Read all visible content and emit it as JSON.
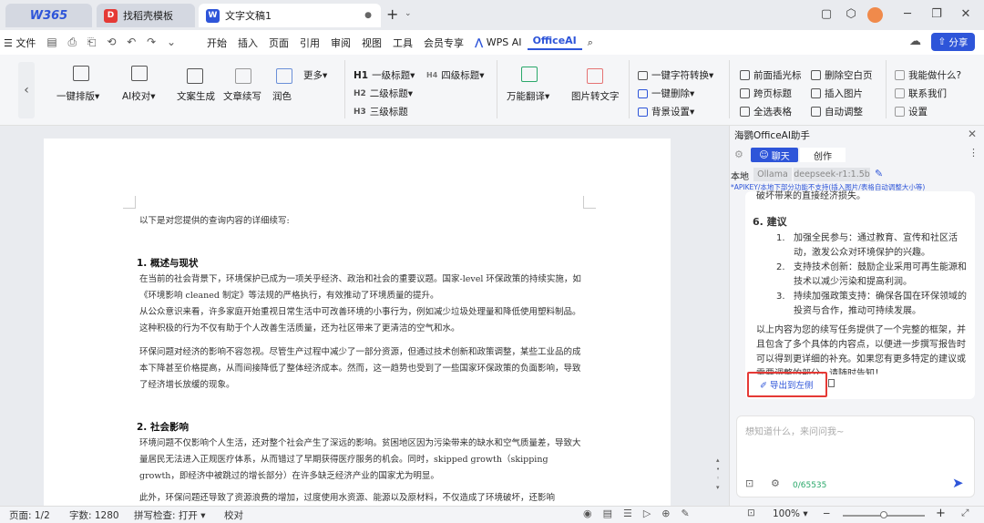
{
  "titlebar": {
    "home_tab": "W365",
    "template_tab": "找稻壳模板",
    "doc_tab": "文字文稿1",
    "new_tab": "+"
  },
  "menubar": {
    "file": "文件",
    "items": [
      "开始",
      "插入",
      "页面",
      "引用",
      "审阅",
      "视图",
      "工具",
      "会员专享"
    ],
    "wps_ai": "WPS AI",
    "office_ai": "OfficeAI",
    "share": "分享"
  },
  "ribbon": {
    "one_click_layout": "一键排版",
    "ai_proofread": "AI校对",
    "text_gen": "文案生成",
    "text_continue": "文章续写",
    "polish": "润色",
    "more": "更多",
    "h1": "一级标题",
    "h2": "二级标题",
    "h3": "三级标题",
    "h4": "四级标题",
    "translate": "万能翻译",
    "img_to_text": "图片转文字",
    "convert": "一键字符转换",
    "delete": "一键删除",
    "bg_settings": "背景设置",
    "cursor_front": "前面插光标",
    "cross_page_title": "跨页标题",
    "select_table": "全选表格",
    "delete_blank": "删除空白页",
    "insert_image": "插入图片",
    "auto_adjust": "自动调整",
    "what_can_do": "我能做什么?",
    "contact": "联系我们",
    "settings": "设置"
  },
  "document": {
    "intro": "以下是对您提供的查询内容的详细续写:",
    "s1_title": "1. 概述与现状",
    "s1_p1": "在当前的社会背景下，环境保护已成为一项关乎经济、政治和社会的重要议题。国家-level 环保政策的持续实施，如《环境影响 cleaned 制定》等法规的严格执行，有效推动了环境质量的提升。",
    "s1_p2": "从公众意识来看，许多家庭开始重视日常生活中可改善环境的小事行为，例如减少垃圾处理量和降低使用塑料制品。这种积极的行为不仅有助于个人改善生活质量，还为社区带来了更清洁的空气和水。",
    "s1_p3": "环保问题对经济的影响不容忽视。尽管生产过程中减少了一部分资源，但通过技术创新和政策调整，某些工业品的成本下降甚至价格提高，从而间接降低了整体经济成本。然而，这一趋势也受到了一些国家环保政策的负面影响，导致了经济增长放缓的现象。",
    "s2_title": "2. 社会影响",
    "s2_p1": "环境问题不仅影响个人生活，还对整个社会产生了深远的影响。贫困地区因为污染带来的缺水和空气质量差，导致大量居民无法进入正规医疗体系，从而错过了早期获得医疗服务的机会。同时，skipped growth（skipping growth，即经济中被跳过的增长部分）在许多缺乏经济产业的国家尤为明显。",
    "s2_p2": "此外，环保问题还导致了资源浪费的增加，过度使用水资源、能源以及原材料，不仅造成了环境破坏，还影响"
  },
  "panel": {
    "title": "海鹦OfficeAI助手",
    "chat_tab": "聊天",
    "create_tab": "创作",
    "local": "本地",
    "model_provider": "Ollama",
    "model": "deepseek-r1:1.5b",
    "hint": "*APIKEY/本地下部分功能不支持(插入图片/表格自动调整大小等)",
    "prev_line": "破坏带来的直接经济损失。",
    "s6_title": "6. 建议",
    "items": [
      {
        "num": "1.",
        "text": "加强全民参与：通过教育、宣传和社区活动，激发公众对环境保护的兴趣。"
      },
      {
        "num": "2.",
        "text": "支持技术创新：鼓励企业采用可再生能源和技术以减少污染和提高利润。"
      },
      {
        "num": "3.",
        "text": "持续加强政策支持：确保各国在环保领域的投资与合作，推动可持续发展。"
      }
    ],
    "summary": "以上内容为您的续写任务提供了一个完整的框架，并且包含了多个具体的内容点，以便进一步撰写报告时可以得到更详细的补充。如果您有更多特定的建议或需要调整的部分，请随时告知！",
    "export_btn": "导出到左侧",
    "input_placeholder": "想知道什么，来问问我~",
    "char_count": "0/65535"
  },
  "statusbar": {
    "page": "页面: 1/2",
    "words": "字数: 1280",
    "spellcheck": "拼写检查: 打开",
    "proofread": "校对",
    "zoom": "100%"
  },
  "colors": {
    "accent": "#2e55d9",
    "highlight_box": "#e53935"
  }
}
